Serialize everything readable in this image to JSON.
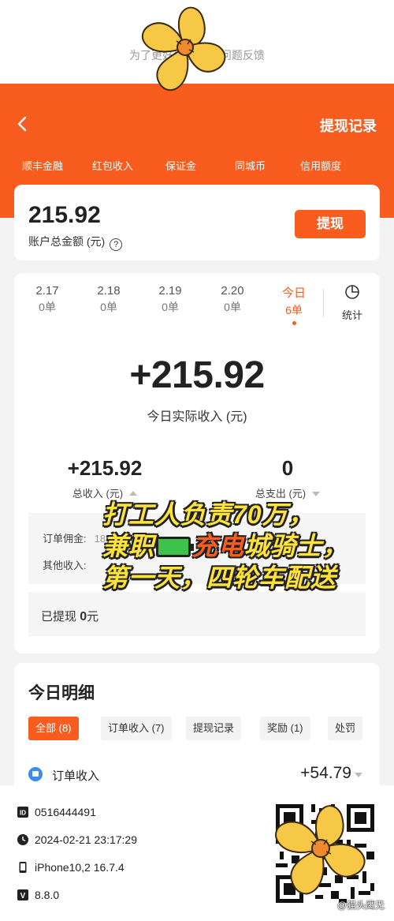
{
  "hint": "为了更好地解 进行问题反馈",
  "header": {
    "record_link": "提现记录",
    "tabs": [
      "顺丰金融",
      "红包收入",
      "保证金",
      "同城币",
      "信用额度"
    ]
  },
  "balance": {
    "amount": "215.92",
    "label": "账户总金额 (元)",
    "help": "?",
    "withdraw_button": "提现"
  },
  "days": [
    {
      "date": "2.17",
      "orders": "0单"
    },
    {
      "date": "2.18",
      "orders": "0单"
    },
    {
      "date": "2.19",
      "orders": "0单"
    },
    {
      "date": "2.20",
      "orders": "0单"
    },
    {
      "date": "今日",
      "orders": "6单"
    }
  ],
  "stats_label": "统计",
  "today": {
    "income": "+215.92",
    "label": "今日实际收入 (元)"
  },
  "summary": {
    "total_income": "+215.92",
    "total_income_label": "总收入 (元)",
    "total_expense": "0",
    "total_expense_label": "总支出 (元)"
  },
  "breakdown": {
    "order_commission_label": "订单佣金:",
    "order_commission_value": "185.92元",
    "order_commission_right": "30元",
    "other_income_label": "其他收入:"
  },
  "withdrawn": {
    "label": "已提现",
    "amount": "0",
    "unit": "元"
  },
  "overlay": {
    "line1": "打工人负责70万，",
    "line2_a": "兼职",
    "line2_censor": "充电",
    "line2_b": "城骑士，",
    "line3": "第一天，四轮车配送"
  },
  "details": {
    "title": "今日明细",
    "filters": [
      "全部 (8)",
      "订单收入 (7)",
      "提现记录",
      "奖励 (1)",
      "处罚"
    ],
    "first_item_label": "订单收入",
    "first_item_amount": "+54.79"
  },
  "meta": {
    "id": "0516444491",
    "time": "2024-02-21 23:17:29",
    "device": "iPhone10,2 16.7.4",
    "version": "8.8.0"
  },
  "watermark": "@猫头鹰无",
  "colors": {
    "accent": "#f85d1f",
    "overlay_text": "#ffe23a",
    "flower": "#f7c746"
  }
}
